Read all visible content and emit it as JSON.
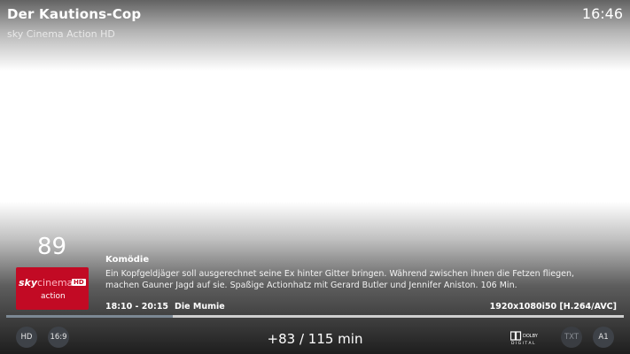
{
  "header": {
    "title": "Der Kautions-Cop",
    "channel": "sky Cinema Action HD",
    "clock": "16:46"
  },
  "channel": {
    "number": "89",
    "logo": {
      "brand": "sky",
      "name": "cinema",
      "hd": "HD",
      "sub": "action",
      "color": "#c20a24"
    }
  },
  "program": {
    "genre": "Komödie",
    "description": "Ein Kopfgeldjäger soll ausgerechnet seine Ex hinter Gitter bringen. Während zwischen ihnen die Fetzen fliegen, machen Gauner Jagd auf sie. Spaßige Actionhatz mit Gerard Butler und Jennifer Aniston. 106 Min.",
    "time_range": "18:10 - 20:15",
    "next": "Die Mumie",
    "video_format": "1920x1080i50 [H.264/AVC]",
    "progress": 0.27
  },
  "footer": {
    "badges_left": [
      "HD",
      "16:9"
    ],
    "time_display": "+83 / 115 min",
    "dolby_icon": "dolby-digital-icon",
    "badges_right": [
      "TXT",
      "A1"
    ]
  }
}
